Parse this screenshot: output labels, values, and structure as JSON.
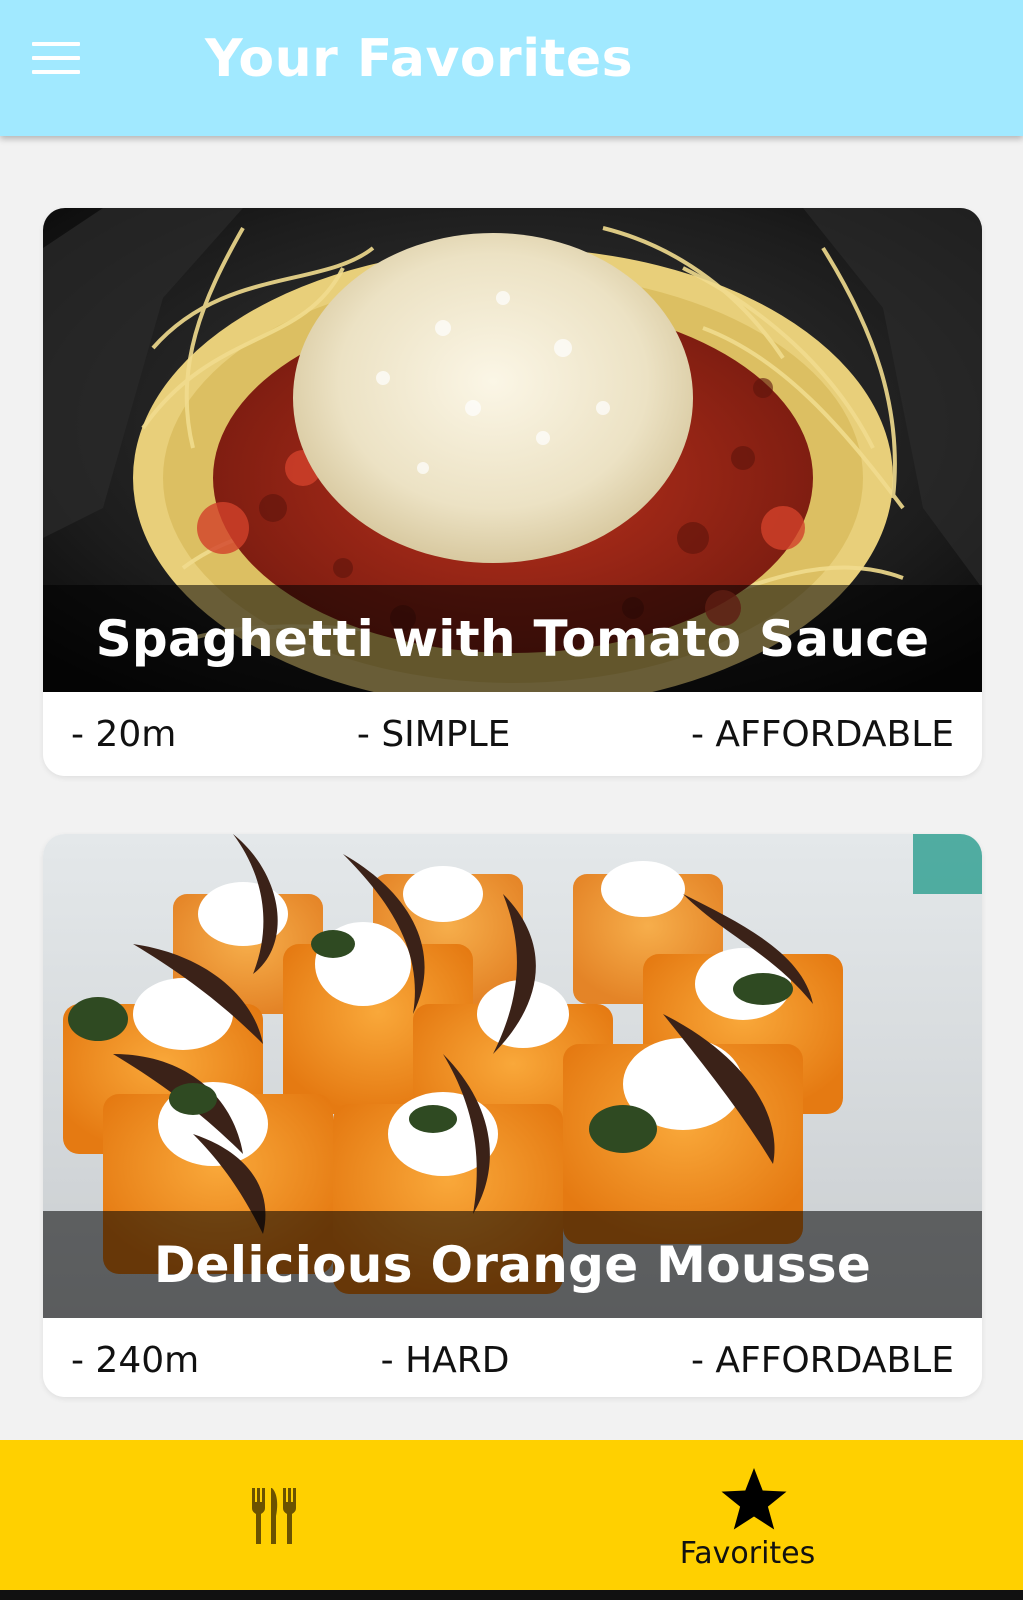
{
  "header": {
    "title": "Your Favorites",
    "menu_icon": "hamburger-menu-icon",
    "background_color": "#a1e9ff"
  },
  "meals": [
    {
      "title": "Spaghetti with Tomato Sauce",
      "duration": "- 20m",
      "complexity": "- SIMPLE",
      "affordability": "- AFFORDABLE",
      "image": "spaghetti-photo"
    },
    {
      "title": "Delicious Orange Mousse",
      "duration": "- 240m",
      "complexity": "- HARD",
      "affordability": "- AFFORDABLE",
      "image": "orange-mousse-photo"
    }
  ],
  "bottom_nav": {
    "background_color": "#ffd000",
    "tabs": [
      {
        "label": "",
        "icon": "cutlery-icon",
        "active": false
      },
      {
        "label": "Favorites",
        "icon": "star-icon",
        "active": true
      }
    ]
  }
}
